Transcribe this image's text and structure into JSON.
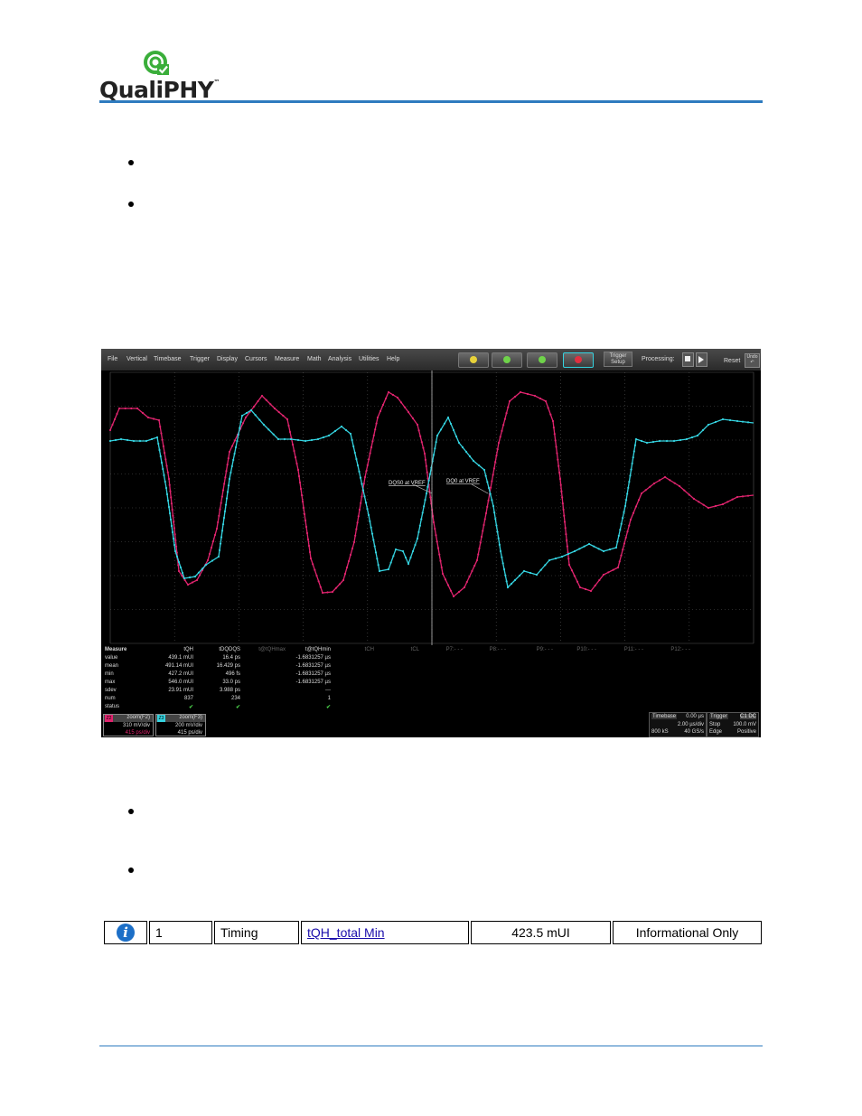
{
  "header": {
    "logo_text": "QualiPHY",
    "logo_tm": "™",
    "accent_color": "#2e7bbf"
  },
  "scope": {
    "menu": [
      "File",
      "Vertical",
      "Timebase",
      "Trigger",
      "Display",
      "Cursors",
      "Measure",
      "Math",
      "Analysis",
      "Utilities",
      "Help"
    ],
    "trigger_setup": [
      "Trigger",
      "Setup"
    ],
    "processing_label": "Processing:",
    "reset_label": "Reset",
    "undo_label": "Undo",
    "annotations": {
      "dqs0": "DQS0 at VREF",
      "dq0": "DQ0 at VREF"
    },
    "trace_colors": {
      "dqs": "#e0246e",
      "dq": "#35d3e0"
    },
    "measure": {
      "title": "Measure",
      "row_labels": [
        "value",
        "mean",
        "min",
        "max",
        "sdev",
        "num",
        "status"
      ],
      "columns": [
        {
          "name": "tQH",
          "active": true,
          "values": [
            "439.1 mUI",
            "491.14 mUI",
            "427.2 mUI",
            "546.0 mUI",
            "23.91 mUI",
            "837",
            "✔"
          ]
        },
        {
          "name": "tDQDQS",
          "active": true,
          "values": [
            "16.4 ps",
            "16.429 ps",
            "496 fs",
            "33.0 ps",
            "3.988 ps",
            "234",
            "✔"
          ]
        },
        {
          "name": "t@tQHmax",
          "active": false,
          "values": [
            "",
            "",
            "",
            "",
            "",
            "",
            ""
          ]
        },
        {
          "name": "t@tQHmin",
          "active": true,
          "values": [
            "-1.6831257 µs",
            "-1.6831257 µs",
            "-1.6831257 µs",
            "-1.6831257 µs",
            "---",
            "1",
            "✔"
          ]
        },
        {
          "name": "tCH",
          "active": false,
          "values": [
            "",
            "",
            "",
            "",
            "",
            "",
            ""
          ]
        },
        {
          "name": "tCL",
          "active": false,
          "values": [
            "",
            "",
            "",
            "",
            "",
            "",
            ""
          ]
        },
        {
          "name": "P7:- - -",
          "active": false,
          "values": [
            "",
            "",
            "",
            "",
            "",
            "",
            ""
          ]
        },
        {
          "name": "P8:- - -",
          "active": false,
          "values": [
            "",
            "",
            "",
            "",
            "",
            "",
            ""
          ]
        },
        {
          "name": "P9:- - -",
          "active": false,
          "values": [
            "",
            "",
            "",
            "",
            "",
            "",
            ""
          ]
        },
        {
          "name": "P10:- - -",
          "active": false,
          "values": [
            "",
            "",
            "",
            "",
            "",
            "",
            ""
          ]
        },
        {
          "name": "P11:- - -",
          "active": false,
          "values": [
            "",
            "",
            "",
            "",
            "",
            "",
            ""
          ]
        },
        {
          "name": "P12:- - -",
          "active": false,
          "values": [
            "",
            "",
            "",
            "",
            "",
            "",
            ""
          ]
        }
      ]
    },
    "zoom_z2": {
      "tag": "Z2",
      "label": "zoom(F2)",
      "vdiv": "310 mV/div",
      "tdiv": "415 ps/div",
      "color": "#e0246e"
    },
    "zoom_z3": {
      "tag": "Z3",
      "label": "zoom(F3)",
      "vdiv": "200 mV/div",
      "tdiv": "415 ps/div",
      "color": "#35d3e0"
    },
    "timebase": {
      "title": "Timebase",
      "offset": "0.00 µs",
      "per_div": "2.00 µs/div",
      "samples": "800 kS",
      "rate": "40 GS/s"
    },
    "trigger": {
      "title": "Trigger",
      "tag": "C1 DC",
      "mode": "Stop",
      "level": "100.0 mV",
      "type": "Edge",
      "slope": "Positive"
    }
  },
  "result_row": {
    "number": "1",
    "category": "Timing",
    "test_name": "tQH_total Min",
    "value": "423.5 mUI",
    "status": "Informational Only"
  }
}
